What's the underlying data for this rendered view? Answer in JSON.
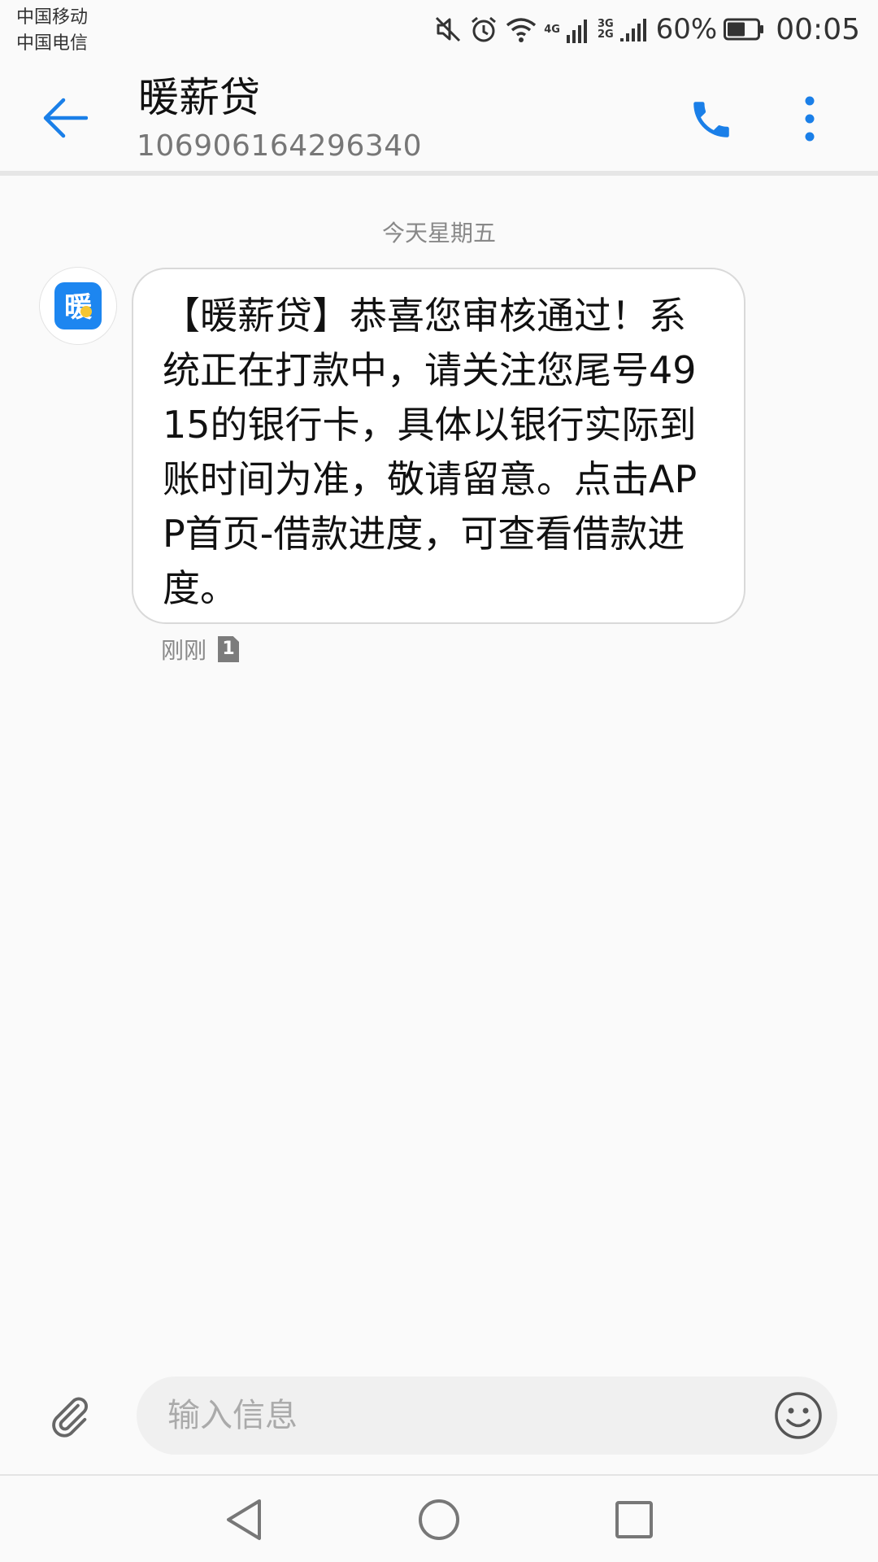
{
  "status_bar": {
    "carrier_1": "中国移动",
    "carrier_2": "中国电信",
    "network_1": "4G",
    "network_2_top": "3G",
    "network_2_bottom": "2G",
    "battery_percent": "60%",
    "battery_level": 0.6,
    "time": "00:05",
    "icons": [
      "mute-icon",
      "alarm-icon",
      "wifi-icon",
      "signal-icon",
      "battery-icon"
    ]
  },
  "header": {
    "contact_name": "暖薪贷",
    "contact_number": "106906164296340",
    "accent_color": "#1a7fe8"
  },
  "conversation": {
    "date_separator": "今天星期五",
    "avatar_logo_text": "暖",
    "messages": [
      {
        "text": "【暖薪贷】恭喜您审核通过！系统正在打款中，请关注您尾号4915的银行卡，具体以银行实际到账时间为准，敬请留意。点击APP首页-借款进度，可查看借款进度。",
        "time": "刚刚",
        "sim": "1"
      }
    ]
  },
  "input_bar": {
    "placeholder": "输入信息"
  }
}
